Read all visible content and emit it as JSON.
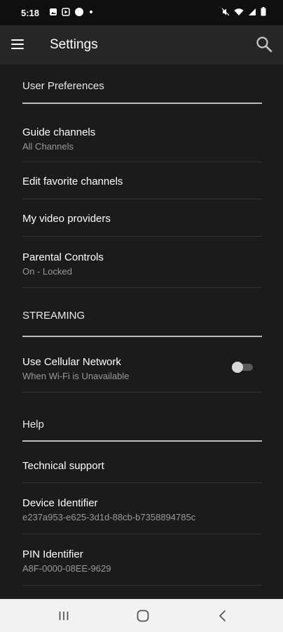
{
  "status_bar": {
    "time": "5:18",
    "icons_left": [
      "photo-icon",
      "play-icon",
      "circle-icon",
      "dot-icon"
    ],
    "icons_right": [
      "mute-icon",
      "wifi-icon",
      "signal-icon",
      "battery-icon"
    ]
  },
  "app_bar": {
    "title": "Settings",
    "menu_icon": "hamburger-menu-icon",
    "search_icon": "search-icon"
  },
  "sections": {
    "user_preferences": {
      "header": "User Preferences",
      "items": [
        {
          "title": "Guide channels",
          "subtitle": "All Channels"
        },
        {
          "title": "Edit favorite channels"
        },
        {
          "title": "My video providers"
        },
        {
          "title": "Parental Controls",
          "subtitle": "On - Locked"
        }
      ]
    },
    "streaming": {
      "header": "STREAMING",
      "items": [
        {
          "title": "Use Cellular Network",
          "subtitle": "When Wi-Fi is Unavailable",
          "toggle_on": false
        }
      ]
    },
    "help": {
      "header": "Help",
      "items": [
        {
          "title": "Technical support"
        },
        {
          "title": "Device Identifier",
          "subtitle": "e237a953-e625-3d1d-88cb-b7358894785c"
        },
        {
          "title": "PIN Identifier",
          "subtitle": "A8F-0000-08EE-9629"
        }
      ]
    }
  },
  "nav_bar": {
    "recents_icon": "recents-icon",
    "home_icon": "home-icon",
    "back_icon": "back-icon"
  },
  "colors": {
    "background": "#1b1b1b",
    "app_bar": "#262626",
    "status_bar": "#0f0f0f",
    "nav_bar": "#f2f2f2",
    "subtitle": "#9a9a9a"
  }
}
